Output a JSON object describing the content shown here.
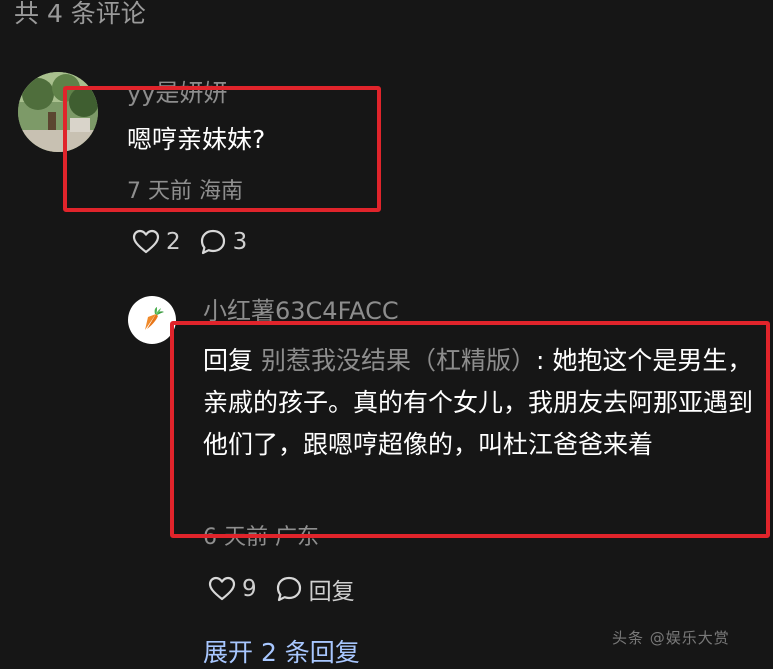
{
  "header": {
    "comment_count": "共 4 条评论"
  },
  "comment": {
    "username": "yy是妍妍",
    "text": "嗯哼亲妹妹?",
    "meta": "7 天前 海南",
    "likes": "2",
    "replies": "3"
  },
  "reply": {
    "username": "小红薯63C4FACC",
    "prefix": "回复",
    "target": "别惹我没结果（杠精版）",
    "separator": ": ",
    "text": "她抱这个是男生，亲戚的孩子。真的有个女儿，我朋友去阿那亚遇到他们了，跟嗯哼超像的，叫杜江爸爸来着",
    "meta": "6 天前 广东",
    "likes": "9",
    "reply_label": "回复"
  },
  "expand_label": "展开 2 条回复",
  "watermark": "头条 @娱乐大赏",
  "icons": {
    "like": "heart-icon",
    "comment": "comment-bubble-icon",
    "reply_avatar": "carrot-icon"
  },
  "colors": {
    "background": "#161616",
    "highlight": "#e0242b",
    "link": "#a8c7ff"
  }
}
